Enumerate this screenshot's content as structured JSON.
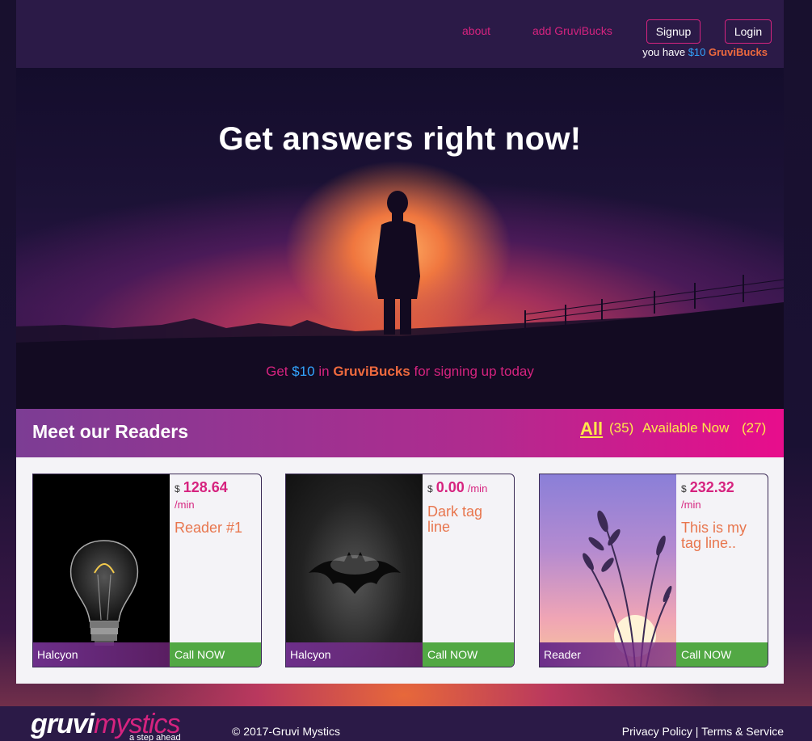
{
  "header": {
    "nav_about": "about",
    "nav_add_bucks": "add GruviBucks",
    "signup_label": "Signup",
    "login_label": "Login",
    "balance_prefix": "you have",
    "balance_amount": "$10",
    "balance_currency": "GruviBucks"
  },
  "hero": {
    "title": "Get answers right now!",
    "promo_prefix": "Get",
    "promo_amount": "$10",
    "promo_in": "in",
    "promo_currency": "GruviBucks",
    "promo_suffix": "for signing up today"
  },
  "readers": {
    "title": "Meet our Readers",
    "filter_all_label": "All",
    "filter_all_count": "(35)",
    "filter_available_label": "Available Now",
    "filter_available_count": "(27)",
    "cards": [
      {
        "currency": "$",
        "price": "128.64",
        "unit": "/min",
        "tagline": "Reader #1",
        "name": "Halcyon",
        "cta": "Call NOW",
        "image_icon": "lightbulb-icon"
      },
      {
        "currency": "$",
        "price": "0.00",
        "unit": "/min",
        "tagline": "Dark tag line",
        "name": "Halcyon",
        "cta": "Call NOW",
        "image_icon": "bat-logo-icon"
      },
      {
        "currency": "$",
        "price": "232.32",
        "unit": "/min",
        "tagline": "This is my tag line..",
        "name": "Reader",
        "cta": "Call NOW",
        "image_icon": "wheat-sunset-icon"
      }
    ]
  },
  "footer": {
    "logo_part1": "gruvi",
    "logo_part2": "mystics",
    "logo_tagline": "a step ahead",
    "copyright": "© 2017-Gruvi Mystics",
    "privacy": "Privacy Policy",
    "separator": "|",
    "terms": "Terms & Service"
  },
  "colors": {
    "brand_pink": "#d6237f",
    "accent_orange": "#ef6a3e",
    "accent_blue": "#33a5ff",
    "cta_green": "#52a844",
    "header_bg": "#2b1a47",
    "filter_yellow": "#ffe94a"
  }
}
